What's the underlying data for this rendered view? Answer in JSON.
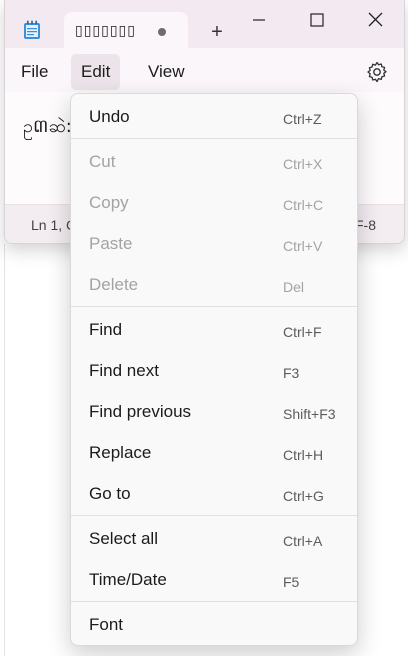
{
  "window": {
    "tab_title": "▯▯▯▯▯▯▯",
    "new_tab_symbol": "+",
    "controls": {
      "minimize": "minimize",
      "maximize": "maximize",
      "close": "close"
    }
  },
  "menubar": {
    "file": "File",
    "edit": "Edit",
    "view": "View"
  },
  "editor": {
    "text": "ဥ៣ဆဲ:"
  },
  "statusbar": {
    "position": "Ln 1, C",
    "encoding": "F-8"
  },
  "edit_menu": {
    "items": [
      {
        "label": "Undo",
        "shortcut": "Ctrl+Z",
        "enabled": true
      },
      {
        "label": "Cut",
        "shortcut": "Ctrl+X",
        "enabled": false
      },
      {
        "label": "Copy",
        "shortcut": "Ctrl+C",
        "enabled": false
      },
      {
        "label": "Paste",
        "shortcut": "Ctrl+V",
        "enabled": false
      },
      {
        "label": "Delete",
        "shortcut": "Del",
        "enabled": false
      },
      {
        "label": "Find",
        "shortcut": "Ctrl+F",
        "enabled": true
      },
      {
        "label": "Find next",
        "shortcut": "F3",
        "enabled": true
      },
      {
        "label": "Find previous",
        "shortcut": "Shift+F3",
        "enabled": true
      },
      {
        "label": "Replace",
        "shortcut": "Ctrl+H",
        "enabled": true
      },
      {
        "label": "Go to",
        "shortcut": "Ctrl+G",
        "enabled": true
      },
      {
        "label": "Select all",
        "shortcut": "Ctrl+A",
        "enabled": true
      },
      {
        "label": "Time/Date",
        "shortcut": "F5",
        "enabled": true
      },
      {
        "label": "Font",
        "shortcut": "",
        "enabled": true
      }
    ]
  },
  "colors": {
    "titlebar": "#f3e9f1",
    "menu_background": "#f9f9f9",
    "disabled_text": "#a3a3a3"
  }
}
